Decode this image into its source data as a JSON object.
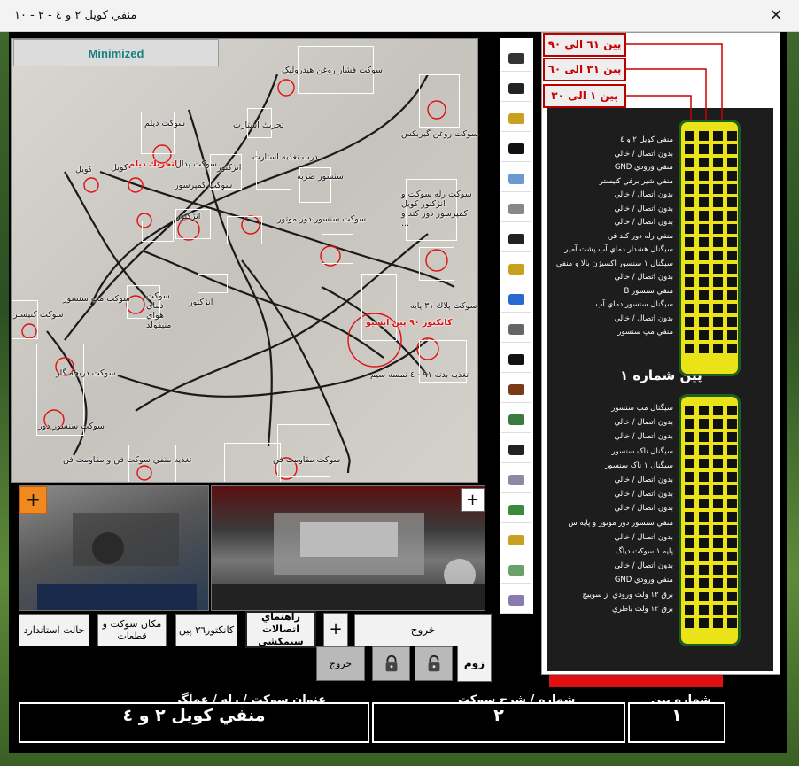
{
  "window": {
    "title": "منفي كويل ٢ و ٤ - ٢ - ١٠",
    "close_label": "✕"
  },
  "wiring": {
    "minimized_label": "Minimized",
    "labels": [
      {
        "text": "سوكت فشار روغن هيدروليک",
        "red": false
      },
      {
        "text": "سوكت روغن گيربكس",
        "red": false
      },
      {
        "text": "سوكت ديلم",
        "red": false
      },
      {
        "text": "تحريك استارت",
        "red": false
      },
      {
        "text": "اتحريك ديلم",
        "red": true
      },
      {
        "text": "كويل",
        "red": false
      },
      {
        "text": "كويل",
        "red": false
      },
      {
        "text": "سوكت پدال",
        "red": false
      },
      {
        "text": "انژكتور",
        "red": false
      },
      {
        "text": "درب تغذيه استارت",
        "red": false
      },
      {
        "text": "سنسور ضربه",
        "red": false
      },
      {
        "text": "سوكت كمپرسور",
        "red": false
      },
      {
        "text": "انژكتور",
        "red": false
      },
      {
        "text": "سوكت سنسور دور موتور",
        "red": false
      },
      {
        "text": "سوكت رله سوكت و انژكتور كويل كمپرسور دور كند و ...",
        "red": false
      },
      {
        "text": "سوكت مپ سنسور",
        "red": false
      },
      {
        "text": "سوكت دماي هواي منيفولد",
        "red": false
      },
      {
        "text": "انژكتور",
        "red": false
      },
      {
        "text": "سوكت كنيستر",
        "red": false
      },
      {
        "text": "كانكتور ٩٠ پين ايسيو",
        "red": true
      },
      {
        "text": "سوكت پلاك ٣١ پايه",
        "red": false
      },
      {
        "text": "سوكت دريچه گاز",
        "red": false
      },
      {
        "text": "سوكت سنسور دور",
        "red": false
      },
      {
        "text": "تغذيه بدنه ٩١ - ٤ نمسه سيم",
        "red": false
      },
      {
        "text": "تغذيه منفي سوكت فن و مقاومت فن",
        "red": false
      },
      {
        "text": "سوكت مقاومت فن",
        "red": false
      }
    ]
  },
  "ecu": {
    "pin_ranges": [
      "پين ٦١ الی ٩٠",
      "پين ٣١ الی ٦٠",
      "پين ١ الی ٣٠"
    ],
    "upper_labels": [
      "منفي كويل ٢ و ٤",
      "بدون اتصال / خالي",
      "منفي ورودي GND",
      "منفي شير برقي كنيستر",
      "بدون اتصال / خالي",
      "بدون اتصال / خالي",
      "بدون اتصال / خالي",
      "منفي رله دور كند فن",
      "سيگنال هشدار دماي آب پشت آمپر",
      "سيگنال ١ سنسور اكسيژن بالا و منفي",
      "بدون اتصال / خالي",
      "منفي سنسور B",
      "سيگنال سنسور دماي آب",
      "بدون اتصال / خالي",
      "منفي مپ سنسور"
    ],
    "pin_number_label": "پين شماره ١",
    "lower_labels": [
      "سيگنال مپ سنسور",
      "بدون اتصال / خالي",
      "بدون اتصال / خالي",
      "سيگنال ناک سنسور",
      "سيگنال ١ ناک سنسور",
      "بدون اتصال / خالي",
      "بدون اتصال / خالي",
      "بدون اتصال / خالي",
      "منفي سنسور دور موتور و پايه س",
      "بدون اتصال / خالي",
      "پايه ١ سوكت دياگ",
      "بدون اتصال / خالي",
      "منفي ورودي GND",
      "برق ١٢ ولت ورودي از سوييچ",
      "برق ١٢ ولت باطري"
    ]
  },
  "buttons": {
    "standard": "حالت استاندارد",
    "location": "مكان سوكت و قطعات",
    "conn36": "كانكتور٣٦ پين",
    "wiring_guide": "راهنماي اتصالات سيمكشي",
    "plus": "+",
    "exit_large": "خروج",
    "exit_small": "خروج",
    "zoom": "زوم",
    "photo_plus": "+"
  },
  "footer": {
    "title_label": "عنوان سوكت / رله / عملگر",
    "title_value": "منفي كويل ٢ و ٤",
    "desc_label": "شماره / شرح سوكت",
    "desc_value": "٢",
    "pin_label": "شماره پين",
    "pin_value": "١"
  },
  "colors": {
    "accent": "#1a7f80",
    "connector": "#e9e317",
    "alert": "#e01010",
    "plus_orange": "#f08a1e"
  }
}
